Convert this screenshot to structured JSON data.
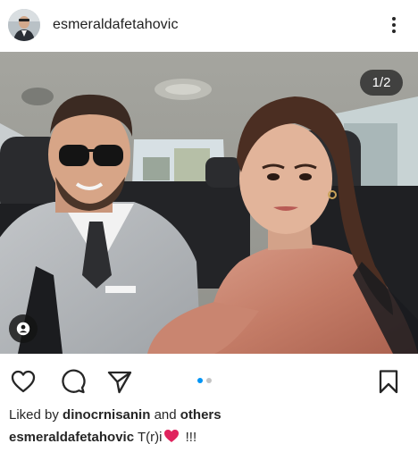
{
  "post": {
    "username": "esmeraldafetahovic",
    "more_icon": "more-vertical-icon",
    "media": {
      "counter": "1/2",
      "tag_icon": "person-tag-icon",
      "carousel_current": 1,
      "carousel_total": 2
    },
    "actions": {
      "like_icon": "heart-outline-icon",
      "comment_icon": "comment-bubble-icon",
      "share_icon": "paper-plane-icon",
      "save_icon": "bookmark-outline-icon"
    },
    "likes": {
      "prefix": "Liked by",
      "user": "dinocrnisanin",
      "connector": "and",
      "others": "others"
    },
    "caption": {
      "username": "esmeraldafetahovic",
      "text": "T(r)i",
      "emoji_icon": "red-heart-emoji",
      "suffix": "!!!"
    }
  },
  "colors": {
    "accent": "#0095f6",
    "text": "#262626",
    "heart": "#e0245e"
  }
}
